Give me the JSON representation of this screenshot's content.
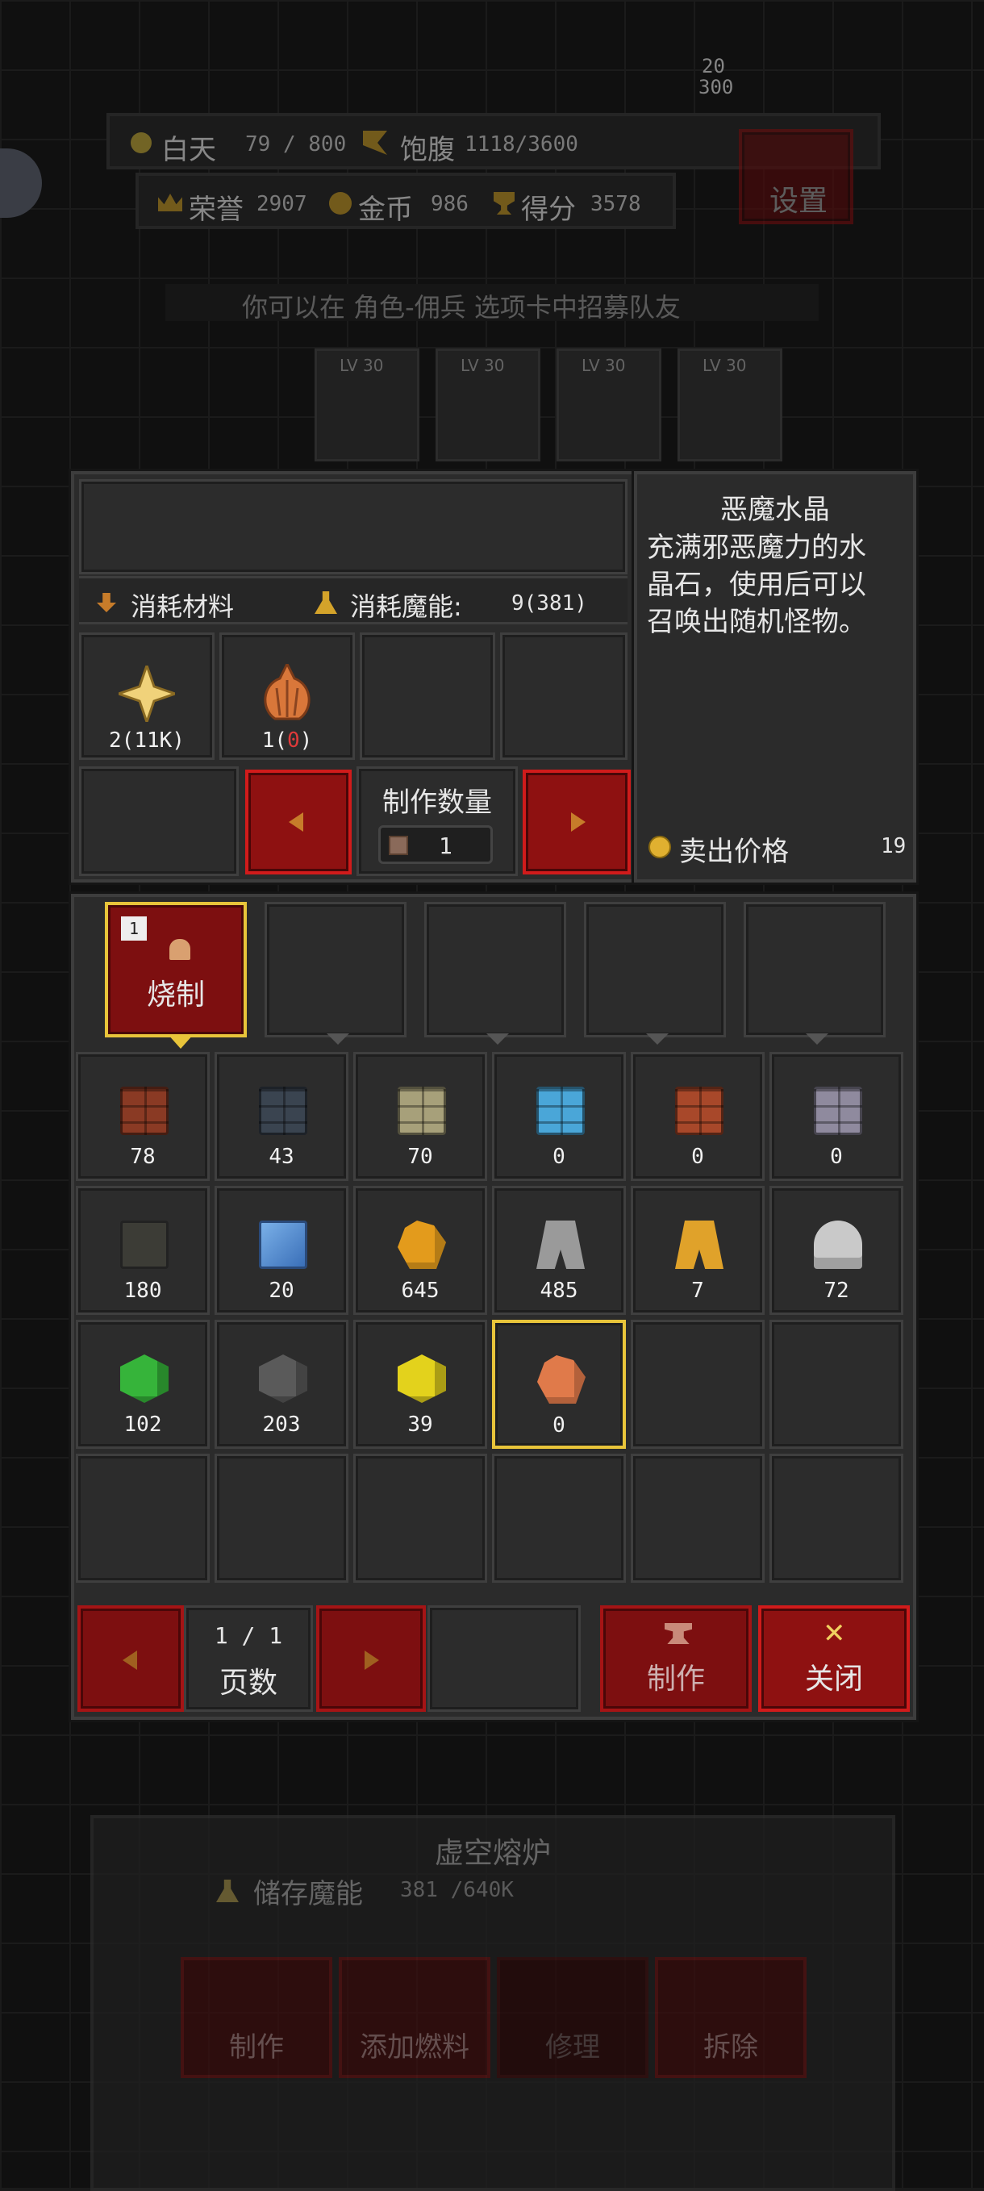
{
  "hud": {
    "day_label": "白天",
    "day_value": "79 / 800",
    "satiety_label": "饱腹",
    "satiety_value": "1118/3600",
    "honor_label": "荣誉",
    "honor_value": "2907",
    "gold_label": "金币",
    "gold_value": "986",
    "score_label": "得分",
    "score_value": "3578",
    "settings_label": "设置",
    "tip": "你可以在 角色-佣兵 选项卡中招募队友",
    "boss_hp_top": "20",
    "boss_hp_bottom": "300",
    "station_level": "LV 30"
  },
  "craft": {
    "materials_label": "消耗材料",
    "magic_label": "消耗魔能:",
    "magic_value": "9(381)",
    "materials": [
      {
        "icon": "sparkle-star-icon",
        "amount": "2(11K)"
      },
      {
        "icon": "onion-bulb-icon",
        "amount_prefix": "1(",
        "amount_zero": "0",
        "amount_suffix": ")"
      }
    ],
    "quantity_label": "制作数量",
    "quantity_value": "1"
  },
  "item_info": {
    "name": "恶魔水晶",
    "description": "充满邪恶魔力的水晶石，使用后可以召唤出随机怪物。",
    "sell_label": "卖出价格",
    "sell_value": "19"
  },
  "category_tabs": [
    {
      "label": "烧制",
      "badge": "1",
      "selected": true
    },
    {
      "label": "",
      "selected": false
    },
    {
      "label": "",
      "selected": false
    },
    {
      "label": "",
      "selected": false
    },
    {
      "label": "",
      "selected": false
    }
  ],
  "inventory": [
    {
      "icon": "red-brick-icon",
      "count": "78",
      "color": "#8a3a24"
    },
    {
      "icon": "dark-slate-brick-icon",
      "count": "43",
      "color": "#3a4450"
    },
    {
      "icon": "sandstone-brick-icon",
      "count": "70",
      "color": "#a7a07a"
    },
    {
      "icon": "ice-brick-icon",
      "count": "0",
      "color": "#4aa6d8"
    },
    {
      "icon": "terracotta-brick-icon",
      "count": "0",
      "color": "#a8482a"
    },
    {
      "icon": "lavender-brick-icon",
      "count": "0",
      "color": "#8f8a9e"
    },
    {
      "icon": "dark-tablet-icon",
      "count": "180",
      "color": "#3c3c36"
    },
    {
      "icon": "glass-pane-icon",
      "count": "20",
      "color": "#5a8fd0"
    },
    {
      "icon": "amber-crystal-icon",
      "count": "645",
      "color": "#e39b1c"
    },
    {
      "icon": "iron-ingot-stack-icon",
      "count": "485",
      "color": "#9a9a9a"
    },
    {
      "icon": "gold-ingot-stack-icon",
      "count": "7",
      "color": "#e0a22a"
    },
    {
      "icon": "silver-ore-icon",
      "count": "72",
      "color": "#c9c9c9"
    },
    {
      "icon": "green-cube-icon",
      "count": "102",
      "color": "#36b43a"
    },
    {
      "icon": "gray-cube-icon",
      "count": "203",
      "color": "#5a5a5a"
    },
    {
      "icon": "yellow-cube-icon",
      "count": "39",
      "color": "#e3d21c"
    },
    {
      "icon": "demon-crystal-icon",
      "count": "0",
      "color": "#e07a4a",
      "selected": true
    }
  ],
  "pager": {
    "page_value": "1 / 1",
    "page_label": "页数",
    "craft_label": "制作",
    "close_label": "关闭"
  },
  "furnace": {
    "title": "虚空熔炉",
    "storage_label": "储存魔能",
    "storage_value": "381 /640K",
    "btn_craft": "制作",
    "btn_fuel": "添加燃料",
    "btn_repair": "修理",
    "btn_dismantle": "拆除"
  }
}
